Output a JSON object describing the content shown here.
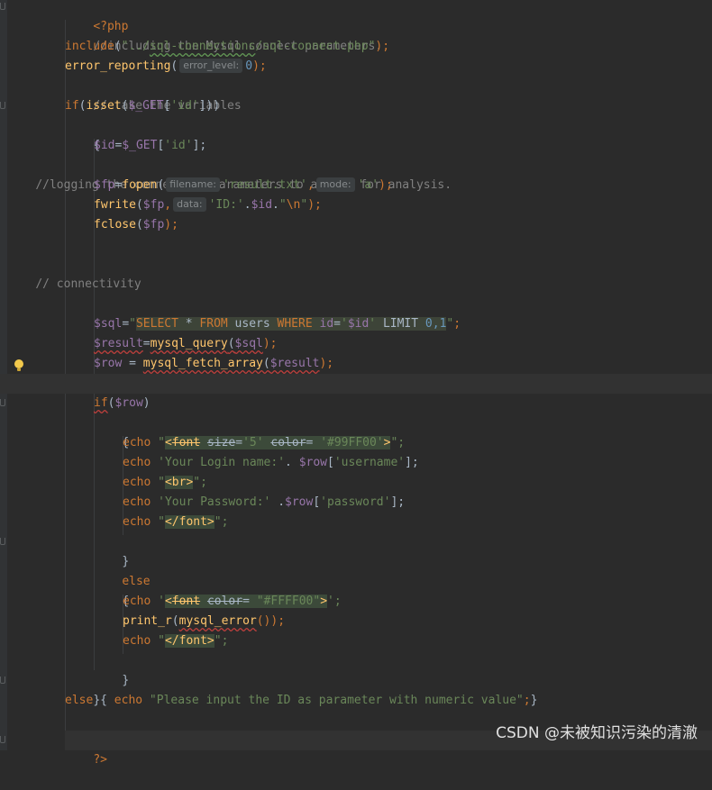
{
  "code": {
    "l01": "<?php",
    "l02": "//including the Mysql connect parameters.",
    "l03_fn": "include",
    "l03_open": "(",
    "l03_str1": "\"../",
    "l03_path1": "sql-connections",
    "l03_str2": "/sql-connect.php\"",
    "l03_close": ");",
    "l04_fn": "error_reporting",
    "l04_open": "(",
    "l04_hint": "error_level:",
    "l04_num": "0",
    "l04_close": ");",
    "l05": "// take the variables",
    "l06_if": "if",
    "l06_open": "(",
    "l06_isset": "isset",
    "l06_paren": "(",
    "l06_var": "$_GET",
    "l06_br1": "[",
    "l06_key": "'id'",
    "l06_br2": "]))",
    "l07": "{",
    "l08_var": "$id",
    "l08_eq": "=",
    "l08_get": "$_GET",
    "l08_br1": "[",
    "l08_key": "'id'",
    "l08_br2": "];",
    "l09": "//logging the connection parameters to a file for analysis.",
    "l10_var": "$fp",
    "l10_eq": "=",
    "l10_fn": "fopen",
    "l10_open": "(",
    "l10_hint1": "filename:",
    "l10_str1": "'result.txt'",
    "l10_comma": ",",
    "l10_hint2": "mode:",
    "l10_str2": "'a'",
    "l10_close": ");",
    "l11_fn": "fwrite",
    "l11_open": "(",
    "l11_var": "$fp",
    "l11_comma": ",",
    "l11_hint": "data:",
    "l11_str1": "'ID:'",
    "l11_dot1": ".",
    "l11_var2": "$id",
    "l11_dot2": ".",
    "l11_q1": "\"",
    "l11_esc": "\\n",
    "l11_q2": "\"",
    "l11_close": ");",
    "l12_fn": "fclose",
    "l12_open": "(",
    "l12_var": "$fp",
    "l12_close": ");",
    "l13": "// connectivity",
    "l14_var": "$sql",
    "l14_eq": "=",
    "l14_q": "\"",
    "l14_select": "SELECT",
    "l14_star": " * ",
    "l14_from": "FROM",
    "l14_tbl": " users ",
    "l14_where": "WHERE",
    "l14_col": " id",
    "l14_eq2": "=",
    "l14_sq1": "'",
    "l14_id": "$id",
    "l14_sq2": "'",
    "l14_limit": " LIMIT ",
    "l14_nums": "0,1",
    "l14_qend": "\"",
    "l14_semi": ";",
    "l15_var": "$result",
    "l15_eq": "=",
    "l15_fn": "mysql_query",
    "l15_open": "(",
    "l15_arg": "$sql",
    "l15_close": ");",
    "l16_var": "$row",
    "l16_eq": " = ",
    "l16_fn": "mysql_fetch_array",
    "l16_open": "(",
    "l16_arg": "$result",
    "l16_close": ");",
    "l17_if": "if",
    "l17_open": "(",
    "l17_var": "$row",
    "l17_close": ")",
    "l18": "{",
    "l19_echo": "echo",
    "l19_q": " \"",
    "l19_lt": "<",
    "l19_font": "font",
    "l19_sp": " ",
    "l19_size": "size",
    "l19_eq1": "=",
    "l19_v1": "'5'",
    "l19_sp2": " ",
    "l19_color": "color",
    "l19_eq2": "= ",
    "l19_v2": "'#99FF00'",
    "l19_gt": ">",
    "l19_end": "\";",
    "l20_echo": "echo",
    "l20_str": " 'Your Login name:'",
    "l20_dot": ". ",
    "l20_var": "$row",
    "l20_br1": "[",
    "l20_key": "'username'",
    "l20_br2": "];",
    "l21_echo": "echo",
    "l21_q": " \"",
    "l21_tag": "<br>",
    "l21_end": "\";",
    "l22_echo": "echo",
    "l22_str": " 'Your Password:'",
    "l22_dot": " .",
    "l22_var": "$row",
    "l22_br1": "[",
    "l22_key": "'password'",
    "l22_br2": "];",
    "l23_echo": "echo",
    "l23_q": " \"",
    "l23_tag": "</font>",
    "l23_end": "\";",
    "l24": "}",
    "l25": "else",
    "l26": "{",
    "l27_echo": "echo",
    "l27_q": " '",
    "l27_lt": "<",
    "l27_font": "font",
    "l27_sp": " ",
    "l27_color": "color",
    "l27_eq": "= ",
    "l27_v": "\"#FFFF00\"",
    "l27_gt": ">",
    "l27_end": "';",
    "l28_fn": "print_r",
    "l28_open": "(",
    "l28_fn2": "mysql_error",
    "l28_close": "());",
    "l29_echo": "echo",
    "l29_q": " \"",
    "l29_tag": "</font>",
    "l29_end": "\";",
    "l30": "}",
    "l31": "}",
    "l32_else": "else",
    "l32_brace": " { ",
    "l32_echo": "echo",
    "l32_str": " \"Please input the ID as parameter with numeric value\"",
    "l32_semi": ";",
    "l32_close": "}",
    "l33": "?>"
  },
  "watermark": "CSDN @未被知识污染的清澈",
  "colors": {
    "background": "#2b2b2b",
    "keyword": "#cc7832",
    "string": "#6a8759",
    "comment": "#808080",
    "function": "#ffc66d",
    "variable": "#9876aa",
    "number": "#6897bb",
    "text": "#a9b7c6"
  },
  "icons": [
    "intention-bulb-icon",
    "fold-marker-icon"
  ]
}
